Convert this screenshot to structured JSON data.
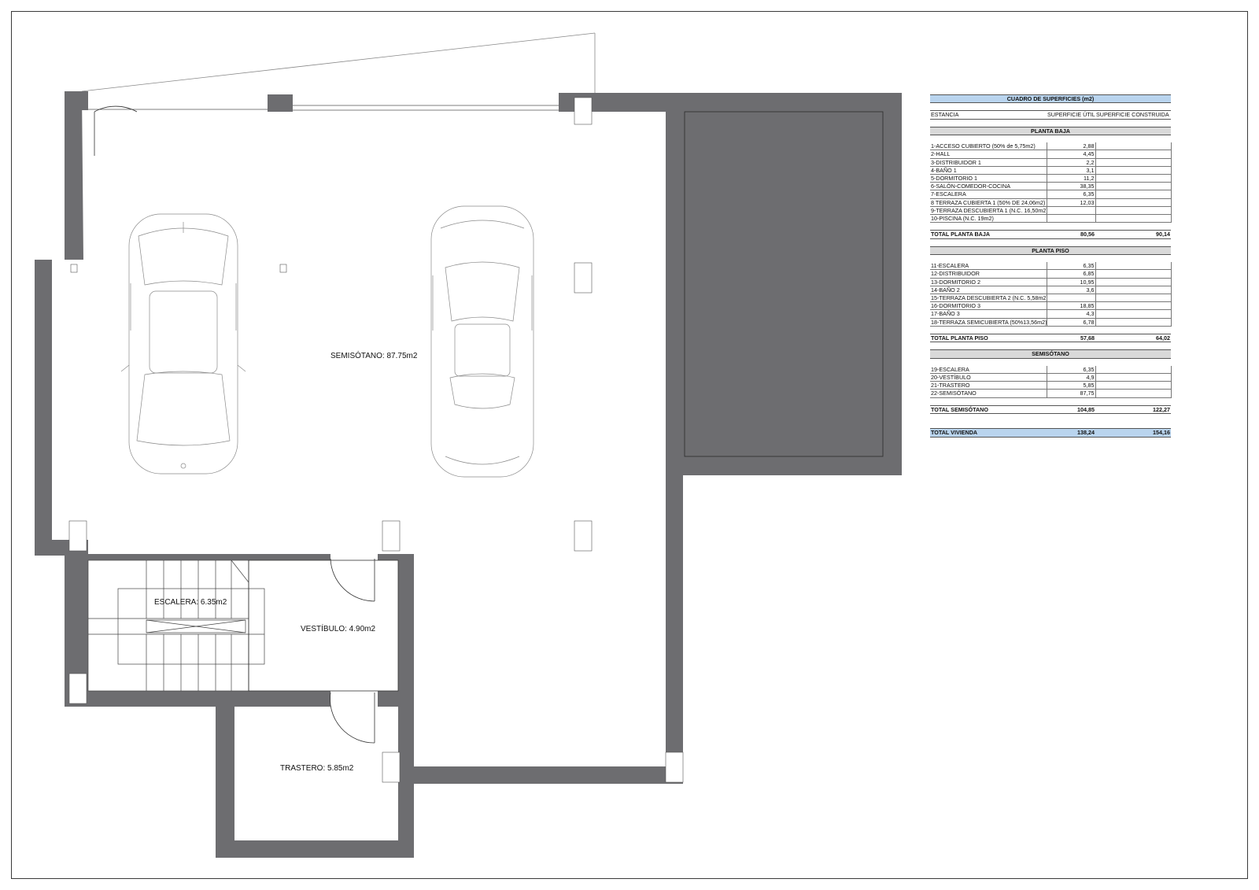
{
  "plan": {
    "room_labels": {
      "semisotano": "SEMISÓTANO: 87.75m2",
      "escalera": "ESCALERA: 6.35m2",
      "vestibulo": "VESTÍBULO: 4.90m2",
      "trastero": "TRASTERO: 5.85m2"
    },
    "colors": {
      "wall": "#6d6d70",
      "line": "#2a2a2a",
      "car": "#8a8a8a"
    }
  },
  "table": {
    "title": "CUADRO DE SUPERFICIES (m2)",
    "col_estancia": "ESTANCIA",
    "col_util": "SUPERFICIE ÚTIL",
    "col_construida": "SUPERFICIE CONSTRUIDA",
    "sections": [
      {
        "name": "PLANTA BAJA",
        "rows": [
          {
            "label": "1-ACCESO CUBIERTO (50% de 5,75m2)",
            "util": "2,88"
          },
          {
            "label": "2-HALL",
            "util": "4,45"
          },
          {
            "label": "3-DISTRIBUIDOR 1",
            "util": "2,2"
          },
          {
            "label": "4-BAÑO 1",
            "util": "3,1"
          },
          {
            "label": "5-DORMITORIO 1",
            "util": "11,2"
          },
          {
            "label": "6-SALÓN-COMEDOR-COCINA",
            "util": "38,35"
          },
          {
            "label": "7-ESCALERA",
            "util": "6,35"
          },
          {
            "label": "8 TERRAZA CUBIERTA 1 (50% DE 24,06m2)",
            "util": "12,03"
          },
          {
            "label": "9-TERRAZA DESCUBIERTA 1 (N.C. 16,50m2)",
            "util": ""
          },
          {
            "label": "10-PISCINA (N.C. 19m2)",
            "util": ""
          }
        ],
        "total_label": "TOTAL PLANTA BAJA",
        "total_util": "80,56",
        "total_construida": "90,14"
      },
      {
        "name": "PLANTA PISO",
        "rows": [
          {
            "label": "11-ESCALERA",
            "util": "6,35"
          },
          {
            "label": "12-DISTRIBUIDOR",
            "util": "6,85"
          },
          {
            "label": "13-DORMITORIO 2",
            "util": "10,95"
          },
          {
            "label": "14-BAÑO 2",
            "util": "3,6"
          },
          {
            "label": "15-TERRAZA DESCUBIERTA 2 (N.C. 5,58m2)",
            "util": ""
          },
          {
            "label": "16-DORMITORIO 3",
            "util": "18,85"
          },
          {
            "label": "17-BAÑO 3",
            "util": "4,3"
          },
          {
            "label": "18-TERRAZA SEMICUBIERTA (50%13,56m2)",
            "util": "6,78"
          }
        ],
        "total_label": "TOTAL PLANTA PISO",
        "total_util": "57,68",
        "total_construida": "64,02"
      },
      {
        "name": "SEMISÓTANO",
        "rows": [
          {
            "label": "19-ESCALERA",
            "util": "6,35"
          },
          {
            "label": "20-VESTÍBULO",
            "util": "4,9"
          },
          {
            "label": "21-TRASTERO",
            "util": "5,85"
          },
          {
            "label": "22-SEMISÓTANO",
            "util": "87,75"
          }
        ],
        "total_label": "TOTAL SEMISÓTANO",
        "total_util": "104,85",
        "total_construida": "122,27"
      }
    ],
    "grand_total_label": "TOTAL VIVIENDA",
    "grand_total_util": "138,24",
    "grand_total_construida": "154,16"
  }
}
